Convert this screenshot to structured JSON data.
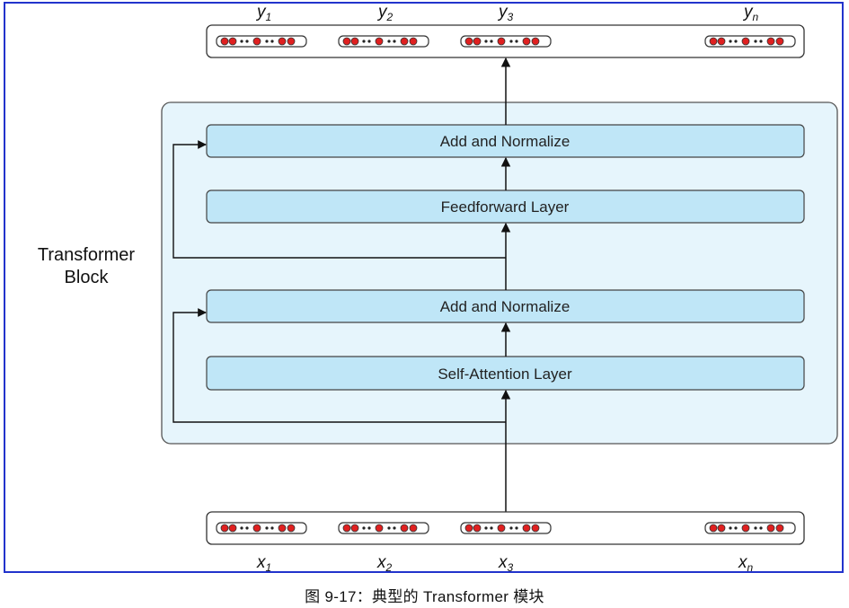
{
  "block": {
    "label_line1": "Transformer",
    "label_line2": "Block"
  },
  "layers": {
    "add_norm_top": "Add and Normalize",
    "feedforward": "Feedforward Layer",
    "add_norm_bottom": "Add and Normalize",
    "self_attention": "Self-Attention Layer"
  },
  "outputs": {
    "labels": [
      {
        "base": "y",
        "sub": "1"
      },
      {
        "base": "y",
        "sub": "2"
      },
      {
        "base": "y",
        "sub": "3"
      },
      {
        "base": "y",
        "sub": "n"
      }
    ]
  },
  "inputs": {
    "labels": [
      {
        "base": "x",
        "sub": "1"
      },
      {
        "base": "x",
        "sub": "2"
      },
      {
        "base": "x",
        "sub": "3"
      },
      {
        "base": "x",
        "sub": "n"
      }
    ]
  },
  "caption": "图 9-17：典型的 Transformer 模块",
  "colors": {
    "frame_border": "#2233cc",
    "block_fill": "#e6f5fc",
    "layer_fill": "#bfe6f7",
    "dot_red": "#e02020",
    "arrow": "#111111"
  }
}
